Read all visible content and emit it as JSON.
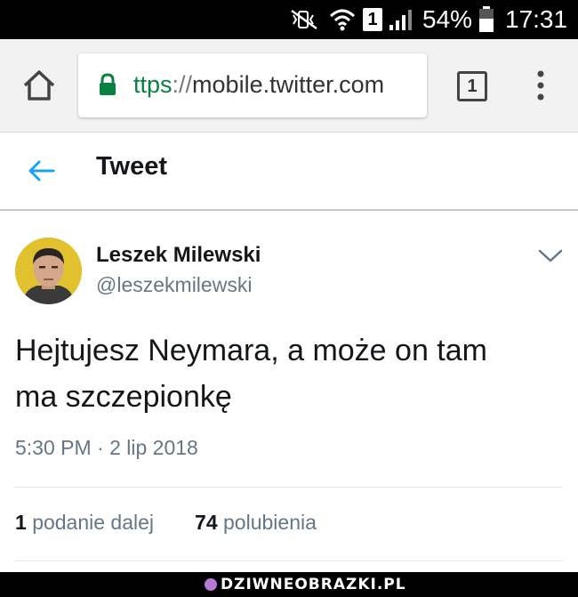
{
  "status_bar": {
    "battery_percent": "54%",
    "time": "17:31",
    "sim_number": "1",
    "icons": [
      "mute-vibrate-icon",
      "wifi-icon",
      "sim-icon",
      "signal-icon",
      "battery-icon"
    ]
  },
  "browser": {
    "url_protocol": "ttps",
    "url_separator": "://",
    "url_host": "mobile.twitter.com",
    "tab_count": "1",
    "icons": [
      "home-icon",
      "lock-icon",
      "tabs-icon",
      "menu-icon"
    ],
    "secure_color": "#0b8043"
  },
  "header": {
    "title": "Tweet",
    "back_color": "#1da1f2"
  },
  "tweet": {
    "author_name": "Leszek Milewski",
    "author_handle": "@leszekmilewski",
    "text_line1": "Hejtujesz Neymara, a może on tam",
    "text_line2": "ma szczepionkę",
    "timestamp": "5:30 PM · 2 lip 2018",
    "retweet_count": "1",
    "retweet_label": "podanie dalej",
    "like_count": "74",
    "like_label": "polubienia"
  },
  "watermark": {
    "text": "DZIWNEOBRAZKI.PL"
  }
}
